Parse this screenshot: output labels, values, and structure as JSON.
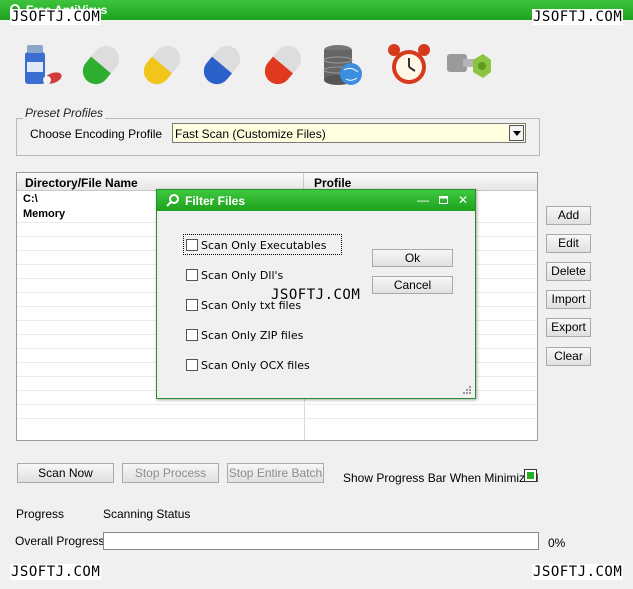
{
  "window": {
    "title": "Free AntiVirus"
  },
  "watermarks": {
    "top_left": "JSOFTJ.COM",
    "top_right": "JSOFTJ.COM",
    "bottom_left": "JSOFTJ.COM",
    "bottom_right": "JSOFTJ.COM",
    "center": "JSOFTJ.COM"
  },
  "toolbar": {
    "icons": [
      "medicine-bottle-icon",
      "green-pill-icon",
      "yellow-pill-icon",
      "blue-pill-icon",
      "red-pill-icon",
      "database-globe-icon",
      "alarm-clock-icon",
      "bolt-nut-icon"
    ]
  },
  "preset": {
    "legend": "Preset Profiles",
    "label": "Choose Encoding Profile",
    "selected": "Fast Scan (Customize Files)"
  },
  "list": {
    "columns": [
      "Directory/File Name",
      "Profile"
    ],
    "rows": [
      "C:\\",
      "Memory"
    ]
  },
  "side_buttons": [
    "Add",
    "Edit",
    "Delete",
    "Import",
    "Export",
    "Clear"
  ],
  "actions": {
    "scan_now": "Scan Now",
    "stop_process": "Stop Process",
    "stop_batch": "Stop Entire Batch",
    "show_progress_label": "Show Progress Bar When Minimized",
    "show_progress_checked": true
  },
  "progress": {
    "label": "Progress",
    "status": "Scanning Status",
    "overall_label": "Overall Progress",
    "overall_value": 0,
    "overall_text": "0%"
  },
  "dialog": {
    "title": "Filter Files",
    "options": [
      {
        "label": "Scan Only Executables",
        "checked": false
      },
      {
        "label": "Scan Only Dll's",
        "checked": false
      },
      {
        "label": "Scan Only txt files",
        "checked": false
      },
      {
        "label": "Scan Only ZIP files",
        "checked": false
      },
      {
        "label": "Scan Only OCX files",
        "checked": false
      }
    ],
    "ok": "Ok",
    "cancel": "Cancel"
  },
  "colors": {
    "accent": "#22b222",
    "combo_bg": "#ffffe0"
  }
}
